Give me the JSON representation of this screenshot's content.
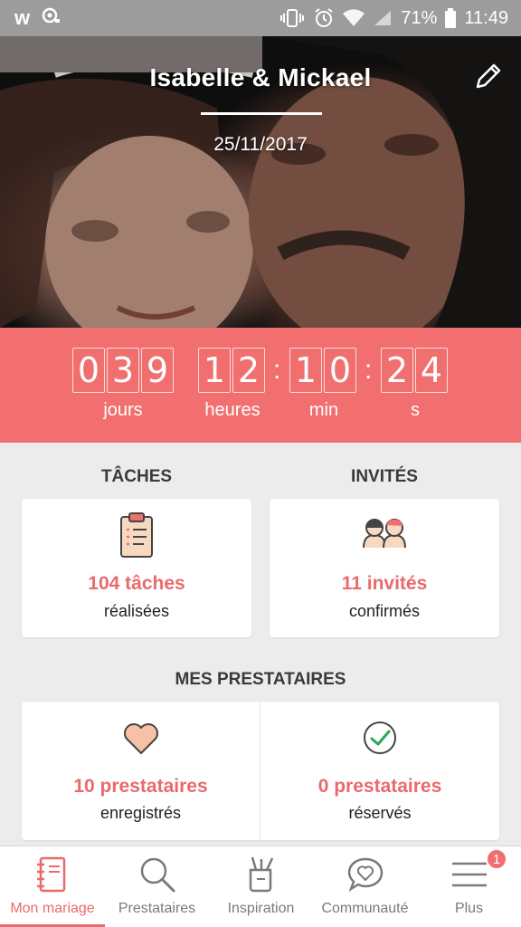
{
  "status_bar": {
    "app_logo": "w",
    "battery_percent": "71%",
    "time": "11:49"
  },
  "header": {
    "couple_names": "Isabelle & Mickael",
    "wedding_date": "25/11/2017"
  },
  "countdown": {
    "days_digits": [
      "0",
      "3",
      "9"
    ],
    "hours_digits": [
      "1",
      "2"
    ],
    "minutes_digits": [
      "1",
      "0"
    ],
    "seconds_digits": [
      "2",
      "4"
    ],
    "separator": ":",
    "labels": {
      "days": "jours",
      "hours": "heures",
      "minutes": "min",
      "seconds": "s"
    }
  },
  "tasks": {
    "title": "TÂCHES",
    "stat": "104 tâches",
    "sub": "réalisées"
  },
  "guests": {
    "title": "INVITÉS",
    "stat": "11 invités",
    "sub": "confirmés"
  },
  "vendors": {
    "title": "MES PRESTATAIRES",
    "saved": {
      "stat": "10 prestataires",
      "sub": "enregistrés"
    },
    "booked": {
      "stat": "0 prestataires",
      "sub": "réservés"
    }
  },
  "bottom_nav": {
    "items": [
      {
        "label": "Mon mariage",
        "icon": "notebook-icon",
        "active": true
      },
      {
        "label": "Prestataires",
        "icon": "search-icon",
        "active": false
      },
      {
        "label": "Inspiration",
        "icon": "inspiration-cup-icon",
        "active": false
      },
      {
        "label": "Communauté",
        "icon": "heart-chat-icon",
        "active": false
      },
      {
        "label": "Plus",
        "icon": "menu-icon",
        "active": false
      }
    ],
    "badge_count": "1"
  },
  "colors": {
    "accent": "#f16f6f",
    "accent_text": "#ea6a6c",
    "background": "#ececec"
  }
}
